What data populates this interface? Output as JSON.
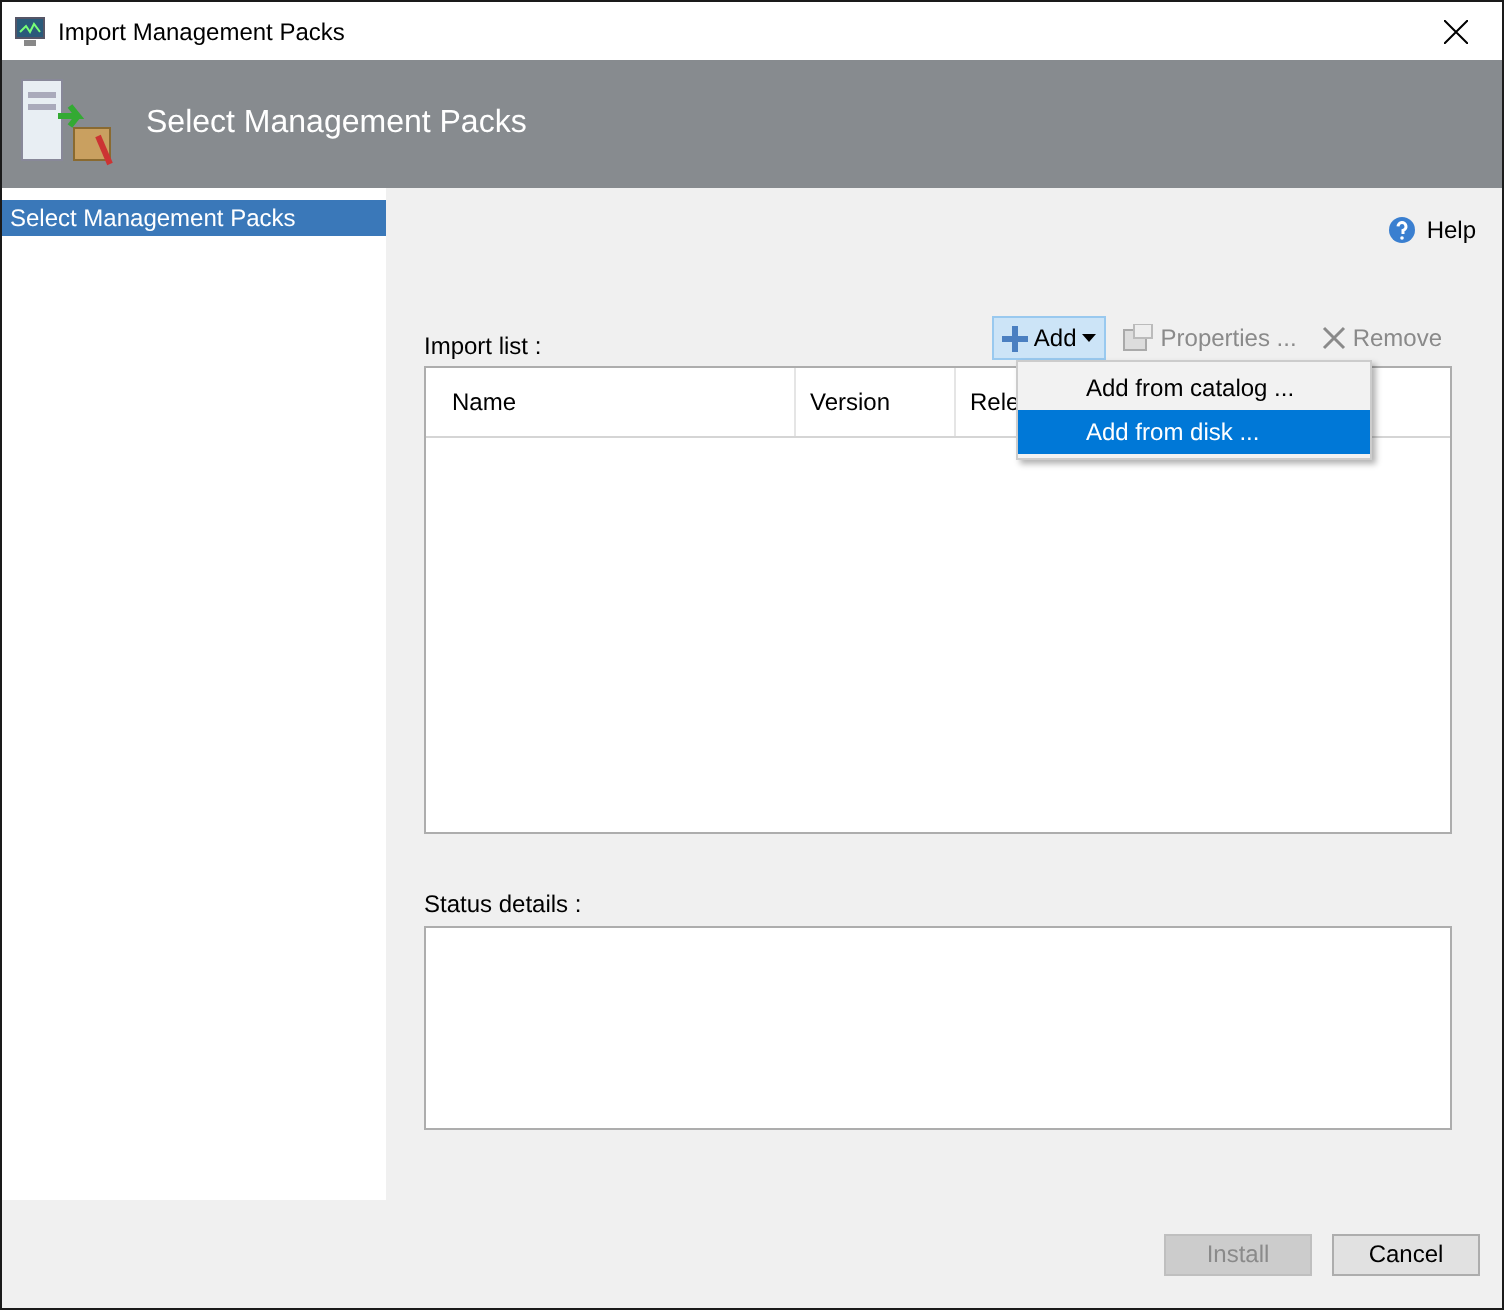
{
  "window": {
    "title": "Import Management Packs"
  },
  "header": {
    "title": "Select Management Packs"
  },
  "sidebar": {
    "items": [
      {
        "label": "Select Management Packs",
        "selected": true
      }
    ]
  },
  "help": {
    "label": "Help"
  },
  "toolbar": [
    {
      "label": "Add",
      "kind": "dropdown",
      "disabled": false,
      "pressed": true
    },
    {
      "label": "Properties ...",
      "kind": "properties",
      "disabled": true,
      "pressed": false
    },
    {
      "label": "Remove",
      "kind": "remove",
      "disabled": true,
      "pressed": false
    }
  ],
  "add_menu": {
    "items": [
      {
        "label": "Add from catalog ...",
        "selected": false
      },
      {
        "label": "Add from disk ...",
        "selected": true
      }
    ]
  },
  "import_list": {
    "label": "Import list :",
    "columns": [
      "Name",
      "Version",
      "Rele"
    ]
  },
  "status_details": {
    "label": "Status details :"
  },
  "buttons": [
    {
      "label": "Install",
      "disabled": true
    },
    {
      "label": "Cancel",
      "disabled": false
    }
  ]
}
